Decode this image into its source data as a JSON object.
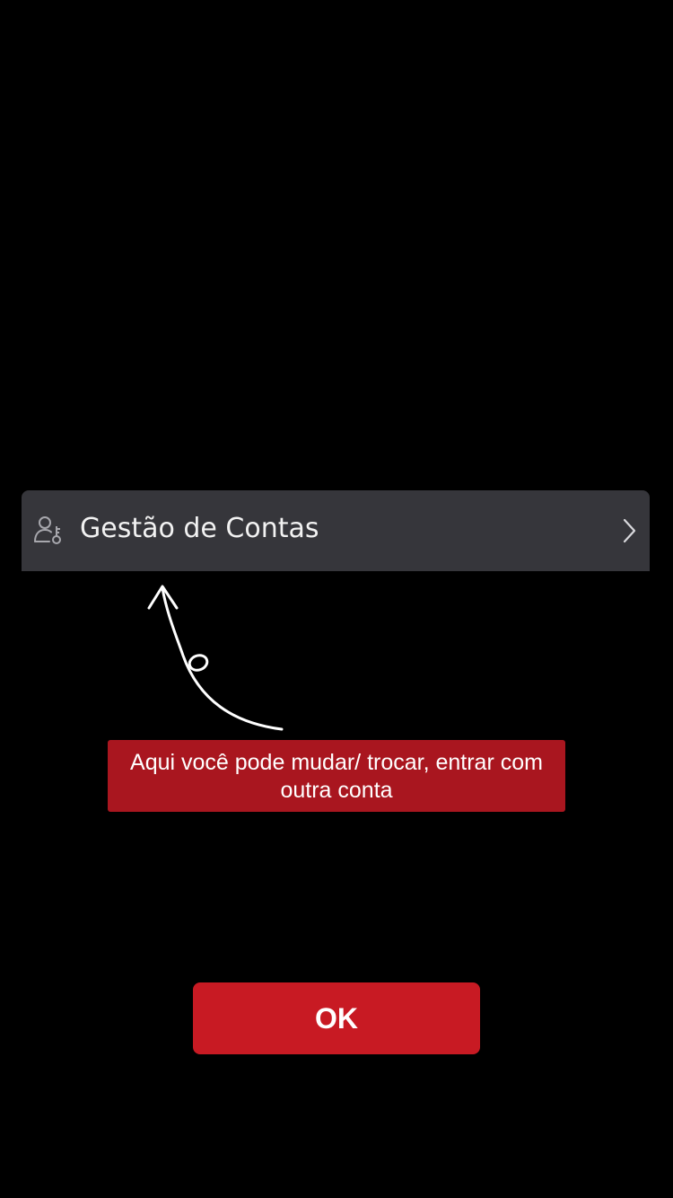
{
  "menu": {
    "account_management_label": "Gestão de Contas",
    "icon": "user-key-icon",
    "chevron_icon": "chevron-right-icon"
  },
  "tooltip": {
    "text": "Aqui você pode mudar/ trocar, entrar com outra conta",
    "arrow_icon": "curved-arrow-up-icon"
  },
  "actions": {
    "ok_label": "OK"
  },
  "colors": {
    "background": "#000000",
    "row_background": "#36363b",
    "tooltip_background": "#a9161f",
    "button_background": "#c81a23",
    "text": "#ffffff"
  }
}
